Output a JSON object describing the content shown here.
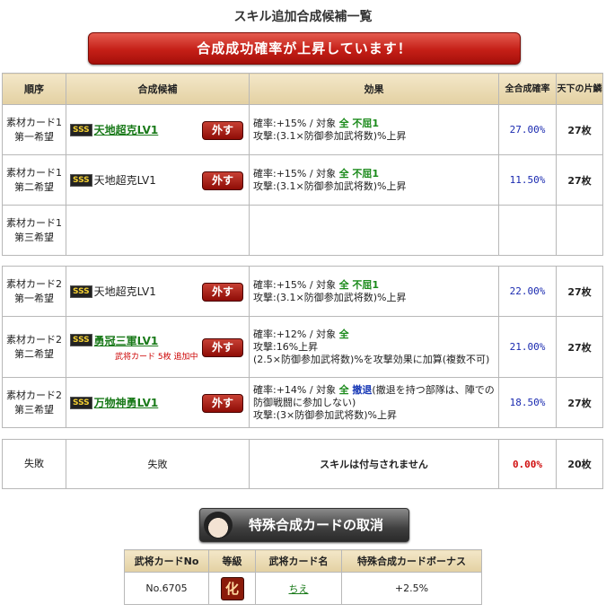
{
  "title": "スキル追加合成候補一覧",
  "banner": "合成成功確率が上昇しています！",
  "headers": {
    "order": "順序",
    "candidate": "合成候補",
    "effect": "効果",
    "rate": "全合成確率",
    "count": "天下の片鱗"
  },
  "remove_label": "外す",
  "sss_label": "SSS",
  "rows": {
    "r1": {
      "order1": "素材カード1",
      "order2": "第一希望",
      "skill": "天地超克LV1",
      "eff1a": "確率:+15% / 対象 ",
      "eff1b": "全 不屈1",
      "eff2": "攻撃:(3.1×防御参加武将数)%上昇",
      "rate": "27.00%",
      "count": "27枚"
    },
    "r2": {
      "order1": "素材カード1",
      "order2": "第二希望",
      "skill": "天地超克LV1",
      "eff1a": "確率:+15% / 対象 ",
      "eff1b": "全 不屈1",
      "eff2": "攻撃:(3.1×防御参加武将数)%上昇",
      "rate": "11.50%",
      "count": "27枚"
    },
    "r3": {
      "order1": "素材カード1",
      "order2": "第三希望"
    },
    "r4": {
      "order1": "素材カード2",
      "order2": "第一希望",
      "skill": "天地超克LV1",
      "eff1a": "確率:+15% / 対象 ",
      "eff1b": "全 不屈1",
      "eff2": "攻撃:(3.1×防御参加武将数)%上昇",
      "rate": "22.00%",
      "count": "27枚"
    },
    "r5": {
      "order1": "素材カード2",
      "order2": "第二希望",
      "skill": "勇冠三軍LV1",
      "sub": "武将カード 5枚 追加中",
      "eff1a": "確率:+12% / 対象 ",
      "eff1b": "全",
      "eff2": "攻撃:16%上昇",
      "eff3": "(2.5×防御参加武将数)%を攻撃効果に加算(複数不可)",
      "rate": "21.00%",
      "count": "27枚"
    },
    "r6": {
      "order1": "素材カード2",
      "order2": "第三希望",
      "skill": "万物神勇LV1",
      "eff1a": "確率:+14% / 対象 ",
      "eff1b": "全 ",
      "eff1c": "撤退",
      "eff1d": "(撤退を持つ部隊は、陣での防御戦闘に参加しない)",
      "eff2": "攻撃:(3×防御参加武将数)%上昇",
      "rate": "18.50%",
      "count": "27枚"
    }
  },
  "fail": {
    "order": "失敗",
    "candidate": "失敗",
    "effect": "スキルは付与されません",
    "rate": "0.00%",
    "count": "20枚"
  },
  "cancel_button": "特殊合成カードの取消",
  "card_table": {
    "headers": [
      "武将カードNo",
      "等級",
      "武将カード名",
      "特殊合成カードボーナス"
    ],
    "no": "No.6705",
    "grade": "化",
    "name": "ちえ",
    "bonus": "+2.5%"
  },
  "colors": {
    "banner": "#c51f17",
    "rate": "#1a2ab0",
    "fail_rate": "#d01010",
    "skill_green": "#1a8a1a"
  },
  "icons": {
    "sss": "sss-badge",
    "face": "general-face-icon"
  }
}
